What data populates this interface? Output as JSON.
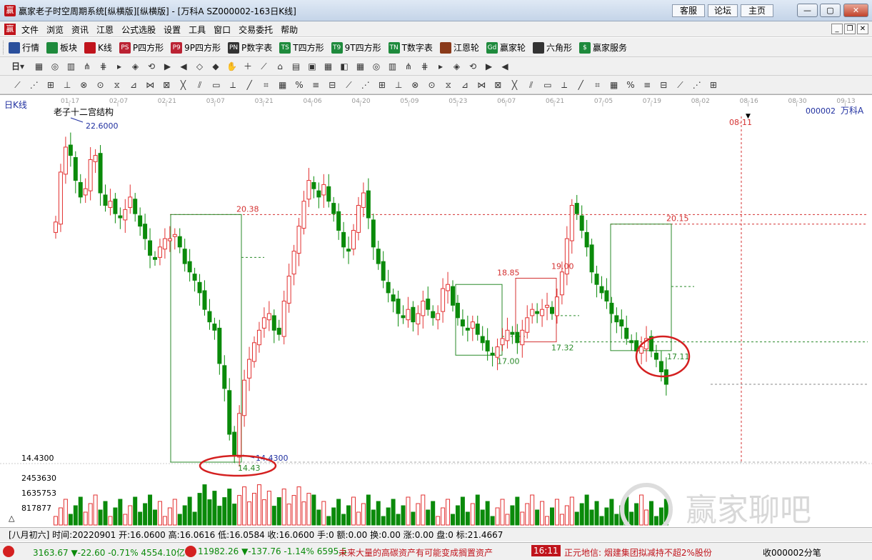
{
  "window": {
    "title": "赢家老子时空周期系统[纵横版][纵横版] - [万科A   SZ000002-163日K线]",
    "links": [
      "客服",
      "论坛",
      "主页"
    ],
    "app_icon": "赢"
  },
  "menu": {
    "items": [
      "文件",
      "浏览",
      "资讯",
      "江恩",
      "公式选股",
      "设置",
      "工具",
      "窗口",
      "交易委托",
      "帮助"
    ]
  },
  "toolbar1": {
    "items": [
      {
        "label": "行情",
        "icon": "grid-icon",
        "color": "#2a4f9c",
        "glyph": ""
      },
      {
        "label": "板块",
        "icon": "blocks-icon",
        "color": "#1e8a3c",
        "glyph": ""
      },
      {
        "label": "K线",
        "icon": "candlestick-icon",
        "color": "#c0141c",
        "glyph": ""
      },
      {
        "label": "P四方形",
        "icon": "p-square-icon",
        "color": "#b23",
        "glyph": "PS"
      },
      {
        "label": "9P四方形",
        "icon": "9p-square-icon",
        "color": "#b23",
        "glyph": "P9"
      },
      {
        "label": "P数字表",
        "icon": "p-number-icon",
        "color": "#333",
        "glyph": "PN"
      },
      {
        "label": "T四方形",
        "icon": "t-square-icon",
        "color": "#1e8a3c",
        "glyph": "TS"
      },
      {
        "label": "9T四方形",
        "icon": "9t-square-icon",
        "color": "#1e8a3c",
        "glyph": "T9"
      },
      {
        "label": "T数字表",
        "icon": "t-number-icon",
        "color": "#1e8a3c",
        "glyph": "TN"
      },
      {
        "label": "江恩轮",
        "icon": "gann-wheel-icon",
        "color": "#8a3a1a",
        "glyph": ""
      },
      {
        "label": "赢家轮",
        "icon": "winner-wheel-icon",
        "color": "#1e8a3c",
        "glyph": "Gd"
      },
      {
        "label": "六角形",
        "icon": "hexagon-icon",
        "color": "#333",
        "glyph": ""
      },
      {
        "label": "赢家服务",
        "icon": "dollar-icon",
        "color": "#1e8a3c",
        "glyph": "$"
      }
    ]
  },
  "toolbar2": {
    "period": "日"
  },
  "chart": {
    "period_label": "日K线",
    "study_title": "老子十二宫结构",
    "stock_code": "000002",
    "stock_name": "万科A",
    "date_axis": [
      "01-17",
      "02-07",
      "02-21",
      "03-07",
      "03-21",
      "04-06",
      "04-20",
      "05-09",
      "05-23",
      "06-07",
      "06-21",
      "07-05",
      "07-19",
      "08-02",
      "08-16",
      "08-30",
      "09-13"
    ],
    "marker_date": "08-11",
    "price_max_label": "22.6000",
    "price_min_label": "14.4300",
    "price_axis_low": "14.4300",
    "volume_axis": [
      "2453630",
      "1635753",
      "817877"
    ],
    "annotations": [
      "20.38",
      "14.43",
      "18.85",
      "19.00",
      "17.00",
      "17.32",
      "20.15",
      "17.11"
    ],
    "colors": {
      "up": "#e23030",
      "down": "#0a8a0a",
      "box": "#2a8a2a",
      "circle": "#d42020",
      "dash": "#d43030"
    }
  },
  "chart_data": {
    "type": "candlestick",
    "title": "老子十二宫结构",
    "x_range": [
      "01-17",
      "09-13"
    ],
    "y_range": [
      14.43,
      22.6
    ],
    "highest": 22.6,
    "lowest": 14.43,
    "levels": [
      20.38,
      14.43,
      18.85,
      19.0,
      17.0,
      17.32,
      20.15,
      17.11
    ],
    "closes": [
      20.2,
      21.4,
      22.0,
      21.8,
      21.2,
      20.8,
      21.0,
      21.7,
      21.8,
      20.9,
      20.6,
      20.7,
      20.4,
      20.3,
      20.5,
      20.8,
      20.4,
      20.1,
      19.8,
      19.4,
      19.3,
      19.6,
      19.8,
      19.8,
      19.9,
      19.6,
      19.2,
      19.0,
      18.8,
      18.5,
      18.1,
      17.8,
      17.6,
      16.8,
      16.2,
      15.1,
      14.6,
      15.6,
      16.4,
      16.9,
      17.3,
      17.6,
      17.9,
      18.0,
      17.6,
      17.5,
      18.3,
      18.9,
      19.5,
      20.1,
      20.7,
      21.2,
      21.0,
      20.8,
      21.1,
      20.7,
      20.4,
      20.0,
      19.6,
      19.5,
      20.0,
      20.6,
      20.9,
      20.3,
      19.6,
      19.2,
      18.8,
      18.5,
      18.3,
      18.0,
      17.9,
      18.1,
      17.8,
      18.0,
      18.3,
      18.1,
      17.9,
      18.0,
      18.6,
      18.7,
      18.2,
      17.9,
      17.7,
      17.6,
      17.8,
      17.5,
      17.3,
      17.1,
      17.0,
      17.2,
      17.4,
      17.6,
      17.5,
      17.3,
      17.6,
      17.9,
      18.1,
      18.0,
      18.1,
      18.2,
      18.0,
      18.4,
      19.0,
      19.8,
      20.6,
      20.4,
      20.0,
      19.6,
      19.0,
      18.7,
      18.5,
      18.3,
      18.0,
      17.8,
      17.7,
      17.4,
      17.3,
      17.1,
      17.2,
      17.4,
      17.1,
      16.9,
      16.6,
      16.3
    ]
  },
  "status": {
    "text": "[八月初六] 时间:20220901 开:16.0600 高:16.0616 低:16.0584 收:16.0600 手:0 额:0.00 换:0.00 涨:0.00 盘:0 标:21.4667"
  },
  "ticker": {
    "sh": "3163.67 ▼-22.60 -0.71% 4554.10亿",
    "sz": "11982.26 ▼-137.76 -1.14% 6595.5",
    "news1": "未来大量的高碳资产有可能变成搁置资产",
    "time": "16:11",
    "news2": "正元地信: 烟建集团拟减持不超2%股份",
    "right": "收000002分笔"
  },
  "watermark": "赢家聊吧"
}
